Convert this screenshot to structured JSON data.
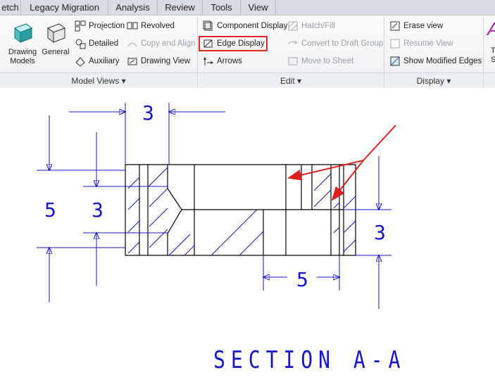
{
  "tabs": [
    {
      "label": "etch"
    },
    {
      "label": "Legacy Migration"
    },
    {
      "label": "Analysis"
    },
    {
      "label": "Review"
    },
    {
      "label": "Tools"
    },
    {
      "label": "View"
    }
  ],
  "ribbon": {
    "model_views": {
      "drawing_models": "Drawing\nModels",
      "general": "General",
      "projection": "Projection",
      "detailed": "Detailed",
      "auxiliary": "Auxiliary",
      "revolved": "Revolved",
      "copy_and_align": "Copy and Align",
      "drawing_view": "Drawing View",
      "footer": "Model Views"
    },
    "edit": {
      "component_display": "Component Display",
      "edge_display": "Edge Display",
      "arrows": "Arrows",
      "hatch_fill": "Hatch/Fill",
      "convert_to_draft_group": "Convert to Draft Group",
      "move_to_sheet": "Move to Sheet",
      "footer": "Edit"
    },
    "display": {
      "erase_view": "Erase view",
      "resume_view": "Resume View",
      "show_modified_edges": "Show Modified Edges",
      "footer": "Display"
    },
    "cut_label_1": "T",
    "cut_label_2": "S"
  },
  "drawing": {
    "dim_top": "3",
    "dim_left_outer": "5",
    "dim_left_inner": "3",
    "dim_right": "3",
    "dim_bottom": "5",
    "caption": "SECTION A-A"
  },
  "colors": {
    "dimension": "#1414c8",
    "geometry": "#000000",
    "arrow_annotation": "#dd1f1f",
    "highlight_box": "#e02424"
  }
}
